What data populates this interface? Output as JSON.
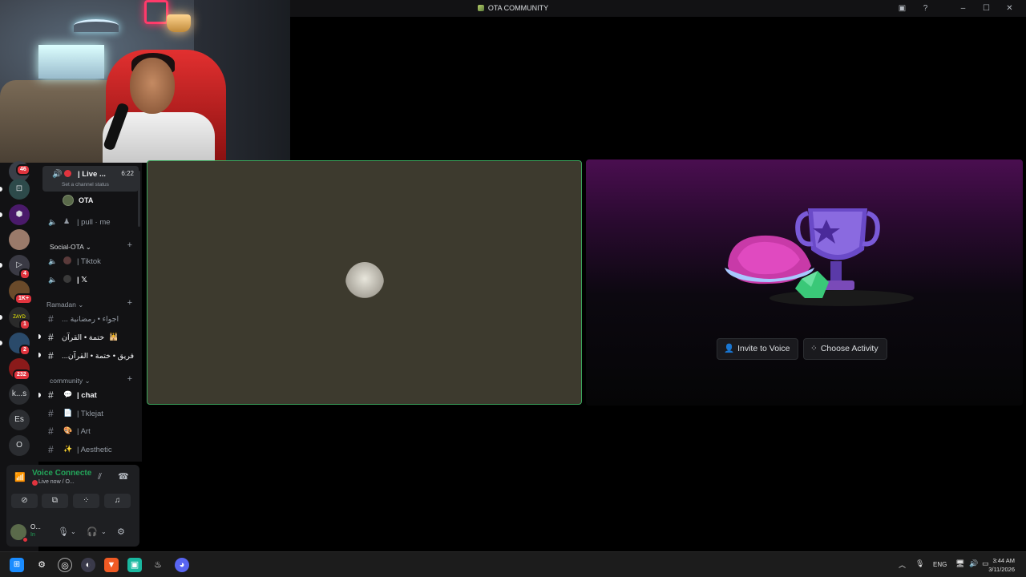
{
  "window": {
    "title": "OTA COMMUNITY"
  },
  "rail": {
    "servers": [
      {
        "badge": "46"
      },
      {
        "badge": ""
      },
      {
        "badge": ""
      },
      {
        "badge": ""
      },
      {
        "badge": "4"
      },
      {
        "badge": "1K+"
      },
      {
        "badge": "1"
      },
      {
        "badge": "2"
      },
      {
        "badge": "232"
      },
      {
        "label": "k...s"
      },
      {
        "label": "Es"
      },
      {
        "label": "O"
      }
    ]
  },
  "channels": {
    "live_channel": {
      "label": "| Live ...",
      "time": "6:22",
      "status": "Set a channel status"
    },
    "voice_member": "OTA",
    "pull_me": "| pull · me",
    "cat_social": "Social-OTA",
    "tiktok": "| Tiktok",
    "x": "| 𝕏",
    "cat_ramadan": "Ramadan",
    "ramadan_1": "... اجواء • رمضانية",
    "ramadan_2": "ختمة • القرآن",
    "ramadan_3": "...فريق • ختمة • القرآن",
    "cat_community": "community",
    "chat": "| chat",
    "tklejat": "| Tklejat",
    "art": "| Art",
    "aesthetic": "| Aesthetic"
  },
  "voice_panel": {
    "title": "Voice Connecte",
    "subtitle": "Live now / O...",
    "user_name": "O...",
    "user_status": "In"
  },
  "main": {
    "invite_label": "Invite to Voice",
    "activity_label": "Choose Activity"
  },
  "taskbar": {
    "lang": "ENG",
    "time": "3:44 AM",
    "date": "3/11/2026"
  },
  "colors": {
    "accent_green": "#23a55a",
    "tile_border": "#3ba55c",
    "badge_red": "#e0343e"
  }
}
